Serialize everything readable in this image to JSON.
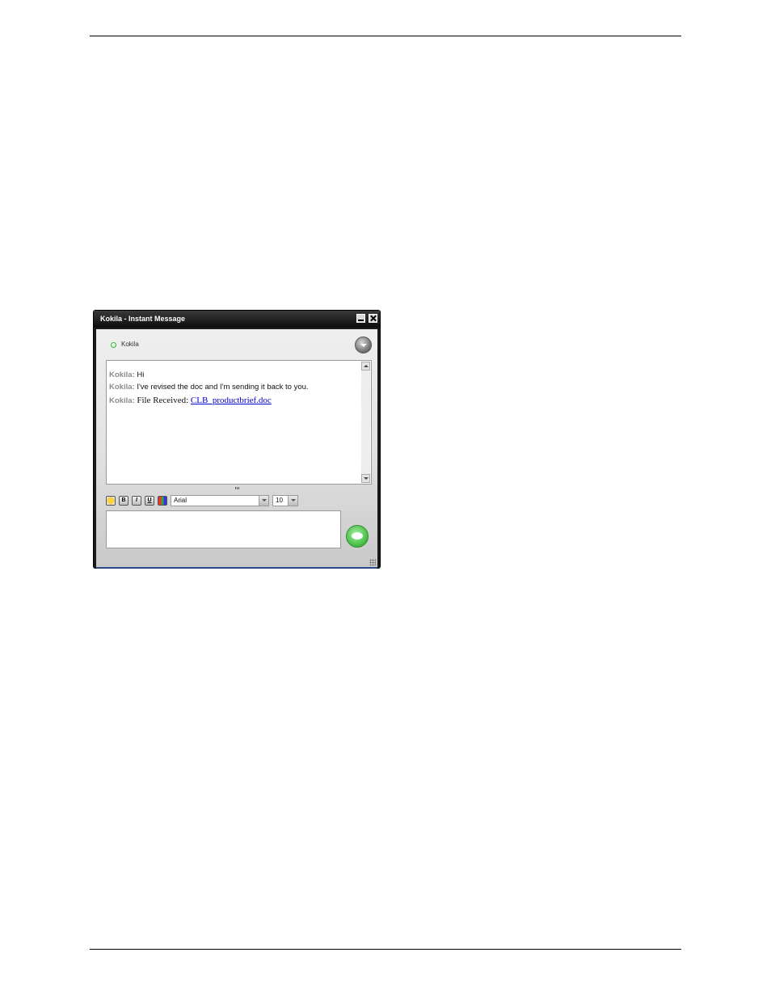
{
  "window": {
    "title": "Kokila - Instant Message"
  },
  "contact": {
    "name": "Kokila",
    "status_color": "#3bb33b"
  },
  "messages": [
    {
      "sender": "Kokila:",
      "text": "Hi"
    },
    {
      "sender": "Kokila:",
      "text": "I've revised the doc and I'm sending it back to you."
    },
    {
      "sender": "Kokila:",
      "text": "File Received: ",
      "link": "CLB_productbrief.doc"
    }
  ],
  "toolbar": {
    "bold_label": "B",
    "italic_label": "I",
    "underline_label": "U",
    "font": "Arial",
    "size": "10"
  },
  "compose": {
    "value": ""
  }
}
